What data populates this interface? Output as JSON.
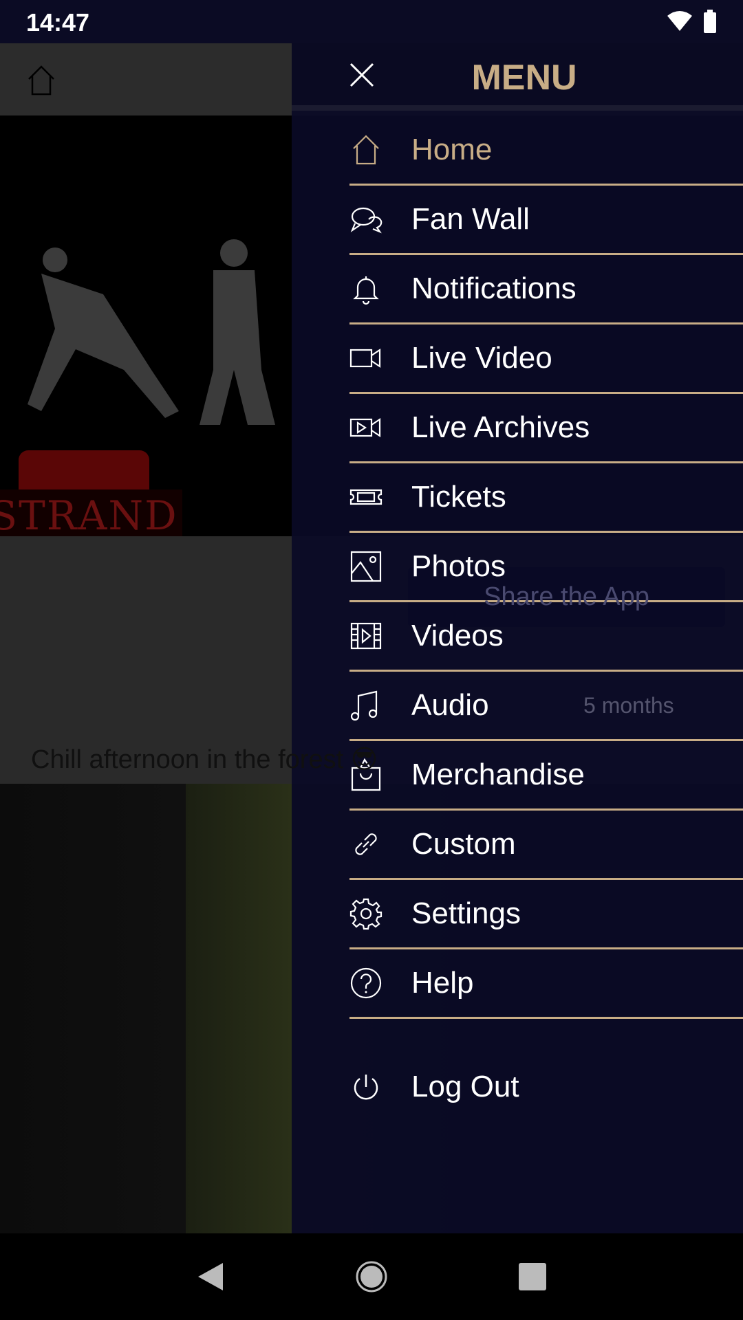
{
  "status": {
    "time": "14:47",
    "icons": [
      "wifi-icon",
      "battery-icon"
    ]
  },
  "background": {
    "logo_text": "STRAND",
    "share_label": "Share the App",
    "post_time": "5 months",
    "post_text": "Chill afternoon in the forest 😎"
  },
  "menu": {
    "title": "MENU",
    "accent": "#c8ad86",
    "items": [
      {
        "label": "Home",
        "icon": "home-icon",
        "active": true
      },
      {
        "label": "Fan Wall",
        "icon": "chat-icon"
      },
      {
        "label": "Notifications",
        "icon": "bell-icon"
      },
      {
        "label": "Live Video",
        "icon": "video-camera-icon"
      },
      {
        "label": "Live Archives",
        "icon": "video-archive-icon"
      },
      {
        "label": "Tickets",
        "icon": "ticket-icon"
      },
      {
        "label": "Photos",
        "icon": "image-icon"
      },
      {
        "label": "Videos",
        "icon": "film-icon"
      },
      {
        "label": "Audio",
        "icon": "music-note-icon"
      },
      {
        "label": "Merchandise",
        "icon": "shopping-bag-icon"
      },
      {
        "label": "Custom",
        "icon": "link-icon"
      },
      {
        "label": "Settings",
        "icon": "gear-icon"
      },
      {
        "label": "Help",
        "icon": "help-icon"
      }
    ],
    "logout": {
      "label": "Log Out",
      "icon": "power-icon"
    }
  }
}
